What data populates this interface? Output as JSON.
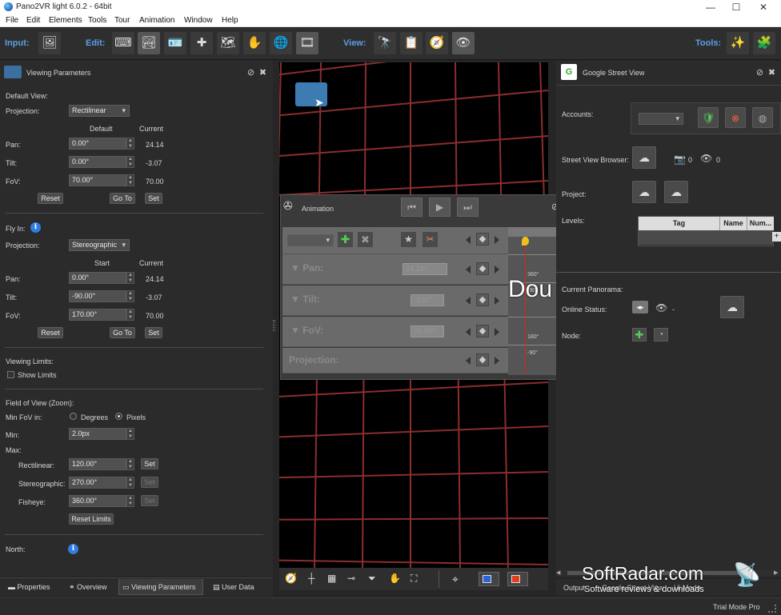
{
  "window": {
    "title": "Pano2VR light 6.0.2 - 64bit",
    "minimize": "—",
    "maximize": "☐",
    "close": "✕"
  },
  "menu": [
    "File",
    "Edit",
    "Elements",
    "Tools",
    "Tour",
    "Animation",
    "Window",
    "Help"
  ],
  "toolbar": {
    "input_label": "Input:",
    "edit_label": "Edit:",
    "view_label": "View:",
    "tools_label": "Tools:"
  },
  "viewing_params": {
    "title": "Viewing Parameters",
    "default_view": "Default View:",
    "projection_label": "Projection:",
    "projection_value": "Rectilinear",
    "col_default": "Default",
    "col_current": "Current",
    "pan_label": "Pan:",
    "pan_value": "0.00°",
    "pan_current": "24.14",
    "tilt_label": "Tilt:",
    "tilt_value": "0.00°",
    "tilt_current": "-3.07",
    "fov_label": "FoV:",
    "fov_value": "70.00°",
    "fov_current": "70.00",
    "reset": "Reset",
    "goto": "Go To",
    "set": "Set",
    "fly_in": "Fly In:",
    "fly_projection_value": "Stereographic",
    "col_start": "Start",
    "fly_pan_value": "0.00°",
    "fly_pan_current": "24.14",
    "fly_tilt_value": "-90.00°",
    "fly_tilt_current": "-3.07",
    "fly_fov_value": "170.00°",
    "fly_fov_current": "70.00",
    "viewing_limits": "Viewing Limits:",
    "show_limits": "Show Limits",
    "fov_zoom": "Field of View (Zoom):",
    "min_fov_in": "Min FoV in:",
    "degrees": "Degrees",
    "pixels": "Pixels",
    "min_label": "Min:",
    "min_value": "2.0px",
    "max_label": "Max:",
    "rect_label": "Rectilinear:",
    "rect_value": "120.00°",
    "stereo_label": "Stereographic:",
    "stereo_value": "270.00°",
    "fisheye_label": "Fisheye:",
    "fisheye_value": "360.00°",
    "reset_limits": "Reset Limits",
    "north": "North:"
  },
  "bottom_tabs": [
    "Properties",
    "Overview",
    "Viewing Parameters",
    "User Data"
  ],
  "animation": {
    "title": "Animation",
    "tracks": [
      "Pan:",
      "Tilt:",
      "FoV:",
      "Projection:"
    ],
    "pan_val": "24.14°",
    "tilt_val": "-3.07°",
    "fov_val": "70.00°",
    "timeline_labels": [
      "360°",
      "-90°",
      "180°",
      "-90°"
    ],
    "overlay_text": "Dou"
  },
  "gsv": {
    "title": "Google Street View",
    "accounts": "Accounts:",
    "sv_browser": "Street View Browser:",
    "photo_count": "0",
    "view_count": "0",
    "project": "Project:",
    "levels": "Levels:",
    "col_tag": "Tag",
    "col_name": "Name",
    "col_num": "Num...",
    "current_panorama": "Current Panorama:",
    "online_status": "Online Status:",
    "status_value": "-",
    "node": "Node:"
  },
  "right_tabs": [
    "Output",
    "Google Street View",
    "Ui Mode"
  ],
  "status": {
    "mode": "Trial Mode Pro"
  },
  "watermark": {
    "brand": "SoftRadar.com",
    "tagline": "Software reviews & downloads"
  },
  "colors": {
    "accent": "#5aa0e6",
    "grid_line": "#8a2e2e",
    "timeline_marker": "#e02020"
  }
}
